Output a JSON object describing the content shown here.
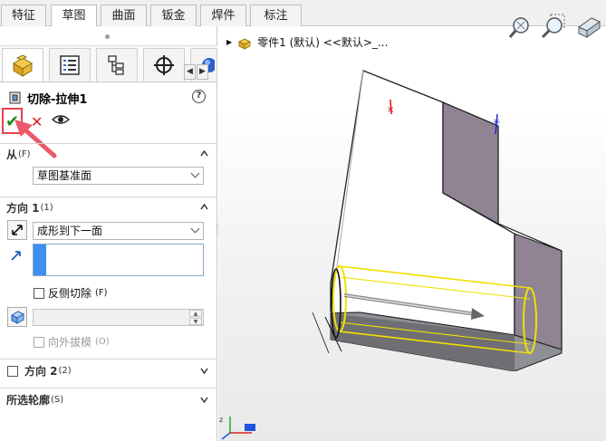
{
  "top_tabs": [
    {
      "label": "特征",
      "active": false
    },
    {
      "label": "草图",
      "active": true
    },
    {
      "label": "曲面",
      "active": false
    },
    {
      "label": "钣金",
      "active": false
    },
    {
      "label": "焊件",
      "active": false
    },
    {
      "label": "标注",
      "active": false
    }
  ],
  "panel_icon_tabs": [
    {
      "icon": "feature-manager-icon",
      "active": true
    },
    {
      "icon": "property-manager-icon",
      "active": false
    },
    {
      "icon": "configuration-manager-icon",
      "active": false
    },
    {
      "icon": "dimxpert-icon",
      "active": false
    },
    {
      "icon": "display-manager-icon",
      "active": false
    }
  ],
  "feature": {
    "title": "切除-拉伸1",
    "help": "?"
  },
  "from_section": {
    "title": "从",
    "shortcut": "(F)",
    "selected": "草图基准面"
  },
  "direction1": {
    "title": "方向 1",
    "shortcut": "(1)",
    "end_condition": "成形到下一面",
    "flip_side_cut": "反侧切除",
    "flip_side_cut_shortcut": "(F)",
    "draft_outward": "向外拔模",
    "draft_outward_shortcut": "(O)"
  },
  "direction2": {
    "title": "方向 2",
    "shortcut": "(2)"
  },
  "selected_contours": {
    "title": "所选轮廓",
    "shortcut": "(S)"
  },
  "tree": {
    "part_name": "零件1 (默认) <<默认>_..."
  },
  "colors": {
    "accent_blue": "#3d8ff0",
    "highlight_red": "#e9424d",
    "ok_green": "#1a8d1a",
    "cancel_red": "#d81e1e",
    "sketch_yellow": "#f0e000"
  }
}
